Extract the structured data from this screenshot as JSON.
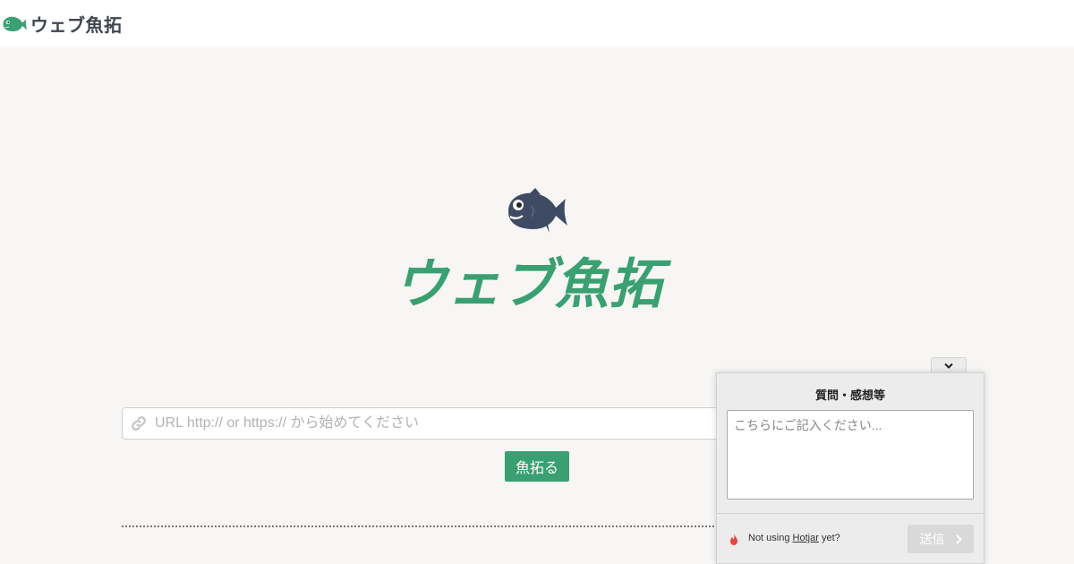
{
  "header": {
    "brand_name": "ウェブ魚拓",
    "brand_icon": "fish-icon"
  },
  "hero": {
    "logo_icon": "fish-icon",
    "title": "ウェブ魚拓"
  },
  "search": {
    "icon": "link-icon",
    "placeholder": "URL http:// or https:// から始めてください",
    "value": "",
    "submit_label": "魚拓る"
  },
  "feedback": {
    "collapse_icon": "chevron-down-icon",
    "title": "質問・感想等",
    "textarea_placeholder": "こちらにご記入ください...",
    "textarea_value": "",
    "footer_prefix": "Not using",
    "footer_link": "Hotjar",
    "footer_suffix": "yet?",
    "flame_icon": "hotjar-flame-icon",
    "send_label": "送信",
    "send_icon": "chevron-right-icon"
  },
  "colors": {
    "brand_green": "#3aa071",
    "fish_navy": "#3f4a63",
    "page_background": "#f7f6f4",
    "send_disabled": "#d9d9d9",
    "flame_red": "#e8453c"
  }
}
